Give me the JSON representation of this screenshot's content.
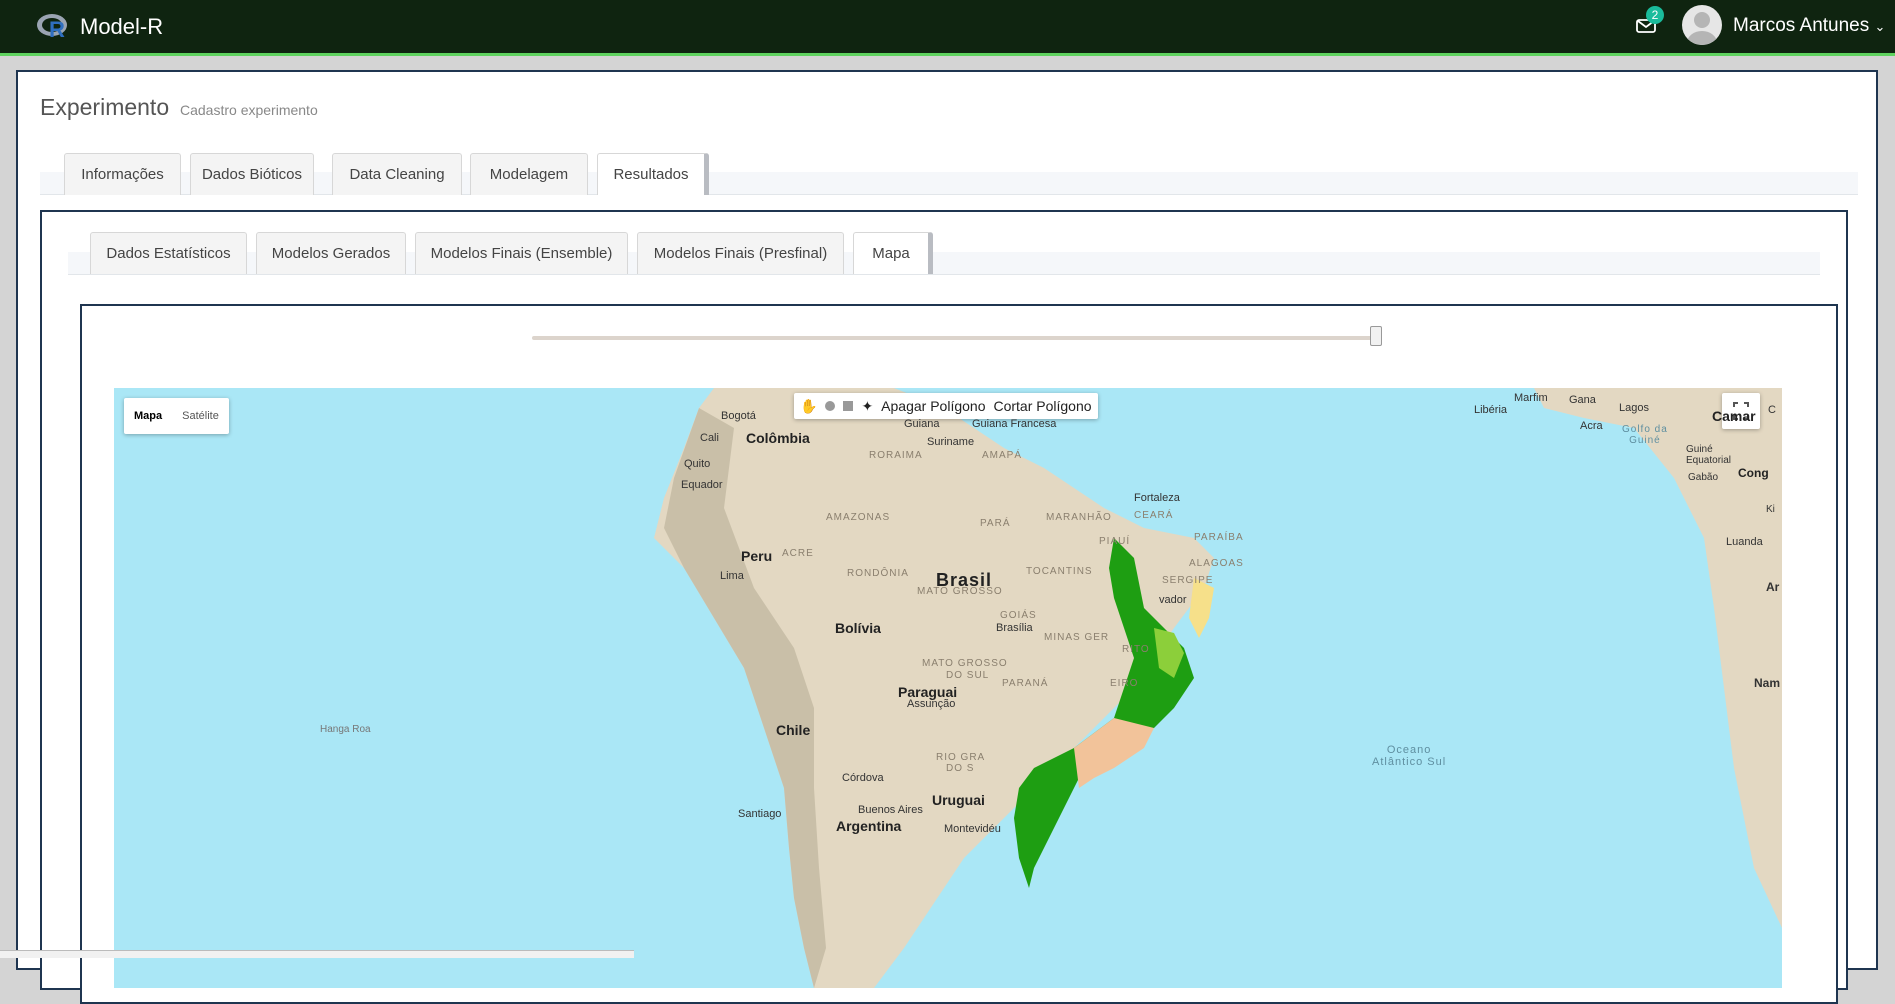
{
  "app": {
    "title": "Model-R"
  },
  "header": {
    "notifications": "2",
    "user_name": "Marcos Antunes"
  },
  "page": {
    "title": "Experimento",
    "subtitle": "Cadastro experimento"
  },
  "main_tabs": [
    "Informações",
    "Dados Bióticos",
    "Data Cleaning",
    "Modelagem",
    "Resultados"
  ],
  "sub_tabs": [
    "Dados Estatísticos",
    "Modelos Gerados",
    "Modelos Finais (Ensemble)",
    "Modelos Finais (Presfinal)",
    "Mapa"
  ],
  "map": {
    "type_control": {
      "map": "Mapa",
      "satellite": "Satélite"
    },
    "draw_toolbar": {
      "clear": "Apagar Polígono",
      "cut": "Cortar Polígono"
    },
    "labels": {
      "brasil": "Brasil",
      "colombia": "Colômbia",
      "peru": "Peru",
      "bolivia": "Bolívia",
      "paraguai": "Paraguai",
      "chile": "Chile",
      "argentina": "Argentina",
      "uruguai": "Uruguai",
      "bogota": "Bogotá",
      "cali": "Cali",
      "quito": "Quito",
      "equador": "Equador",
      "guiana": "Guiana",
      "guiana_francesa": "Guiana\nFrancesa",
      "suriname": "Suriname",
      "roraima": "RORAIMA",
      "amapa": "AMAPÁ",
      "amazonas": "AMAZONAS",
      "para": "PARÁ",
      "maranhao": "MARANHÃO",
      "ceara": "CEARÁ",
      "fortaleza": "Fortaleza",
      "piaui": "PIAUÍ",
      "paraiba": "PARAÍBA",
      "alagoas": "ALAGOAS",
      "sergipe": "SERGIPE",
      "salvador": "vador",
      "acre": "ACRE",
      "rondonia": "RONDÔNIA",
      "tocantins": "TOCANTINS",
      "mato_grosso": "MATO GROSSO",
      "goias": "GOIÁS",
      "brasilia": "Brasília",
      "minas": "MINAS GER",
      "espirito": "RITO",
      "rio": "EIRO",
      "ms1": "MATO GROSSO",
      "ms2": "DO SUL",
      "pr": "PARANÁ",
      "assuncao": "Assunção",
      "lima": "Lima",
      "rs1": "RIO GRA",
      "rs2": "DO S",
      "cordoba": "Córdova",
      "santiago": "Santiago",
      "buenos_aires": "Buenos Aires",
      "montevideo": "Montevidéu",
      "hanga_roa": "Hanga Roa",
      "oceano": "Oceano\nAtlântico Sul",
      "marfim": "Marfim",
      "gana": "Gana",
      "lagos": "Lagos",
      "liberia": "Libéria",
      "acra": "Acra",
      "golfo": "Golfo da\nGuiné",
      "camar": "Camar",
      "guine_eq": "Guiné\nEquatorial",
      "gabao": "Gabão",
      "congo": "Cong",
      "luanda": "Luanda",
      "ki": "Ki",
      "ar": "Ar",
      "nam": "Nam",
      "c": "C"
    }
  },
  "colors": {
    "navbar": "#0f2410",
    "accent": "#5fd35f",
    "badge": "#1abc9c",
    "ocean": "#aae7f6",
    "land": "#e3d8c2",
    "presence_high": "#1e9e12",
    "presence_low": "#f6e08a"
  },
  "map_zoom_slider": 1.0
}
